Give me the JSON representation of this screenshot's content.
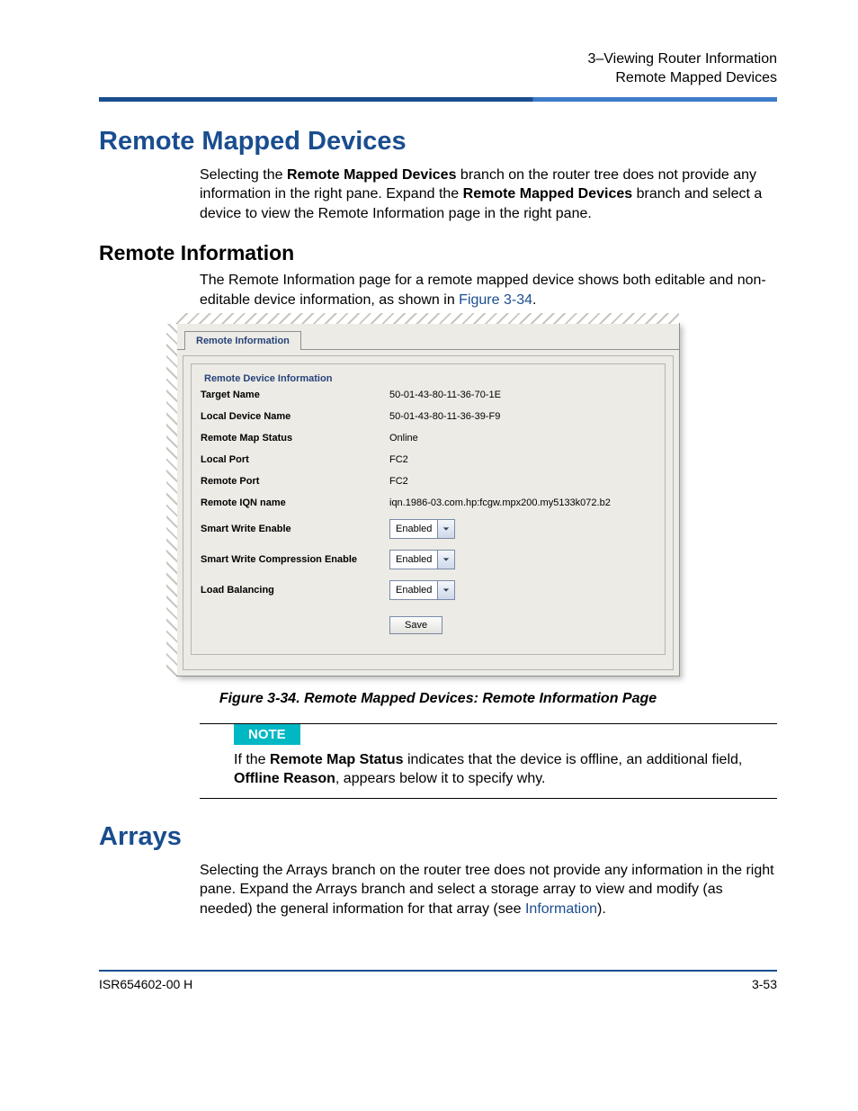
{
  "header": {
    "chapter_line": "3–Viewing Router Information",
    "section_line": "Remote Mapped Devices"
  },
  "h_remote_mapped": "Remote Mapped Devices",
  "p_remote_mapped": {
    "t1": "Selecting the ",
    "b1": "Remote Mapped Devices",
    "t2": " branch on the router tree does not provide any information in the right pane. Expand the ",
    "b2": "Remote Mapped Devices",
    "t3": " branch and select a device to view the Remote Information page in the right pane."
  },
  "h_remote_info": "Remote Information",
  "p_remote_info": {
    "t1": "The Remote Information page for a remote mapped device shows both editable and non-editable device information, as shown in ",
    "link": "Figure 3-34",
    "t2": "."
  },
  "panel": {
    "tab_label": "Remote Information",
    "group_title": "Remote Device Information",
    "rows": {
      "target_name": {
        "label": "Target Name",
        "value": "50-01-43-80-11-36-70-1E"
      },
      "local_device_name": {
        "label": "Local Device Name",
        "value": "50-01-43-80-11-36-39-F9"
      },
      "remote_map_status": {
        "label": "Remote Map Status",
        "value": "Online"
      },
      "local_port": {
        "label": "Local Port",
        "value": "FC2"
      },
      "remote_port": {
        "label": "Remote Port",
        "value": "FC2"
      },
      "remote_iqn": {
        "label": "Remote IQN name",
        "value": "iqn.1986-03.com.hp:fcgw.mpx200.my5133k072.b2"
      },
      "smart_write": {
        "label": "Smart Write Enable",
        "value": "Enabled"
      },
      "smart_write_comp": {
        "label": "Smart Write Compression Enable",
        "value": "Enabled"
      },
      "load_balancing": {
        "label": "Load Balancing",
        "value": "Enabled"
      }
    },
    "save_button": "Save"
  },
  "figure_caption": "Figure 3-34. Remote Mapped Devices: Remote Information Page",
  "note": {
    "tag": "NOTE",
    "t1": "If the ",
    "b1": "Remote Map Status",
    "t2": " indicates that the device is offline, an additional field, ",
    "b2": "Offline Reason",
    "t3": ", appears below it to specify why."
  },
  "h_arrays": "Arrays",
  "p_arrays": {
    "t1": "Selecting the Arrays branch on the router tree does not provide any information in the right pane. Expand the Arrays branch and select a storage array to view and modify (as needed) the general information for that array (see ",
    "link": "Information",
    "t2": ")."
  },
  "footer": {
    "left": "ISR654602-00  H",
    "right": "3-53"
  }
}
